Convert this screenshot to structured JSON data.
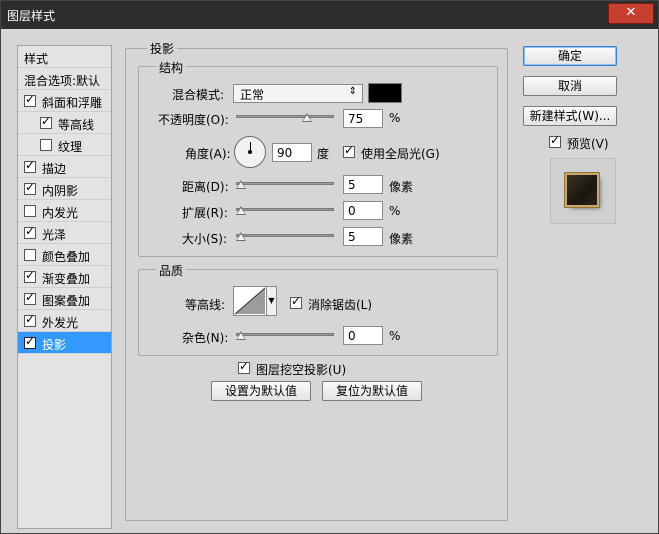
{
  "window": {
    "title": "图层样式",
    "close_label": "✕"
  },
  "style_list": {
    "header": "样式",
    "blend_default": "混合选项:默认",
    "items": [
      {
        "label": "斜面和浮雕",
        "checked": true,
        "indent": false,
        "selected": false
      },
      {
        "label": "等高线",
        "checked": true,
        "indent": true,
        "selected": false
      },
      {
        "label": "纹理",
        "checked": false,
        "indent": true,
        "selected": false
      },
      {
        "label": "描边",
        "checked": true,
        "indent": false,
        "selected": false
      },
      {
        "label": "内阴影",
        "checked": true,
        "indent": false,
        "selected": false
      },
      {
        "label": "内发光",
        "checked": false,
        "indent": false,
        "selected": false
      },
      {
        "label": "光泽",
        "checked": true,
        "indent": false,
        "selected": false
      },
      {
        "label": "颜色叠加",
        "checked": false,
        "indent": false,
        "selected": false
      },
      {
        "label": "渐变叠加",
        "checked": true,
        "indent": false,
        "selected": false
      },
      {
        "label": "图案叠加",
        "checked": true,
        "indent": false,
        "selected": false
      },
      {
        "label": "外发光",
        "checked": true,
        "indent": false,
        "selected": false
      },
      {
        "label": "投影",
        "checked": true,
        "indent": false,
        "selected": true
      }
    ]
  },
  "drop_shadow": {
    "title": "投影",
    "structure": {
      "title": "结构",
      "blend_mode_label": "混合模式:",
      "blend_mode_value": "正常",
      "shadow_color": "#000000",
      "opacity_label": "不透明度(O):",
      "opacity_value": "75",
      "opacity_fraction": 0.75,
      "opacity_unit": "%",
      "angle_label": "角度(A):",
      "angle_value": "90",
      "angle_unit": "度",
      "global_light_label": "使用全局光(G)",
      "global_light_checked": true,
      "distance_label": "距离(D):",
      "distance_value": "5",
      "distance_fraction": 0.0,
      "distance_unit": "像素",
      "spread_label": "扩展(R):",
      "spread_value": "0",
      "spread_fraction": 0.0,
      "spread_unit": "%",
      "size_label": "大小(S):",
      "size_value": "5",
      "size_fraction": 0.0,
      "size_unit": "像素"
    },
    "quality": {
      "title": "品质",
      "contour_label": "等高线:",
      "anti_alias_label": "消除锯齿(L)",
      "anti_alias_checked": true,
      "noise_label": "杂色(N):",
      "noise_value": "0",
      "noise_fraction": 0.0,
      "noise_unit": "%"
    },
    "knockout_label": "图层挖空投影(U)",
    "knockout_checked": true,
    "make_default_label": "设置为默认值",
    "reset_default_label": "复位为默认值"
  },
  "actions": {
    "ok_label": "确定",
    "cancel_label": "取消",
    "new_style_label": "新建样式(W)...",
    "preview_label": "预览(V)",
    "preview_checked": true
  }
}
